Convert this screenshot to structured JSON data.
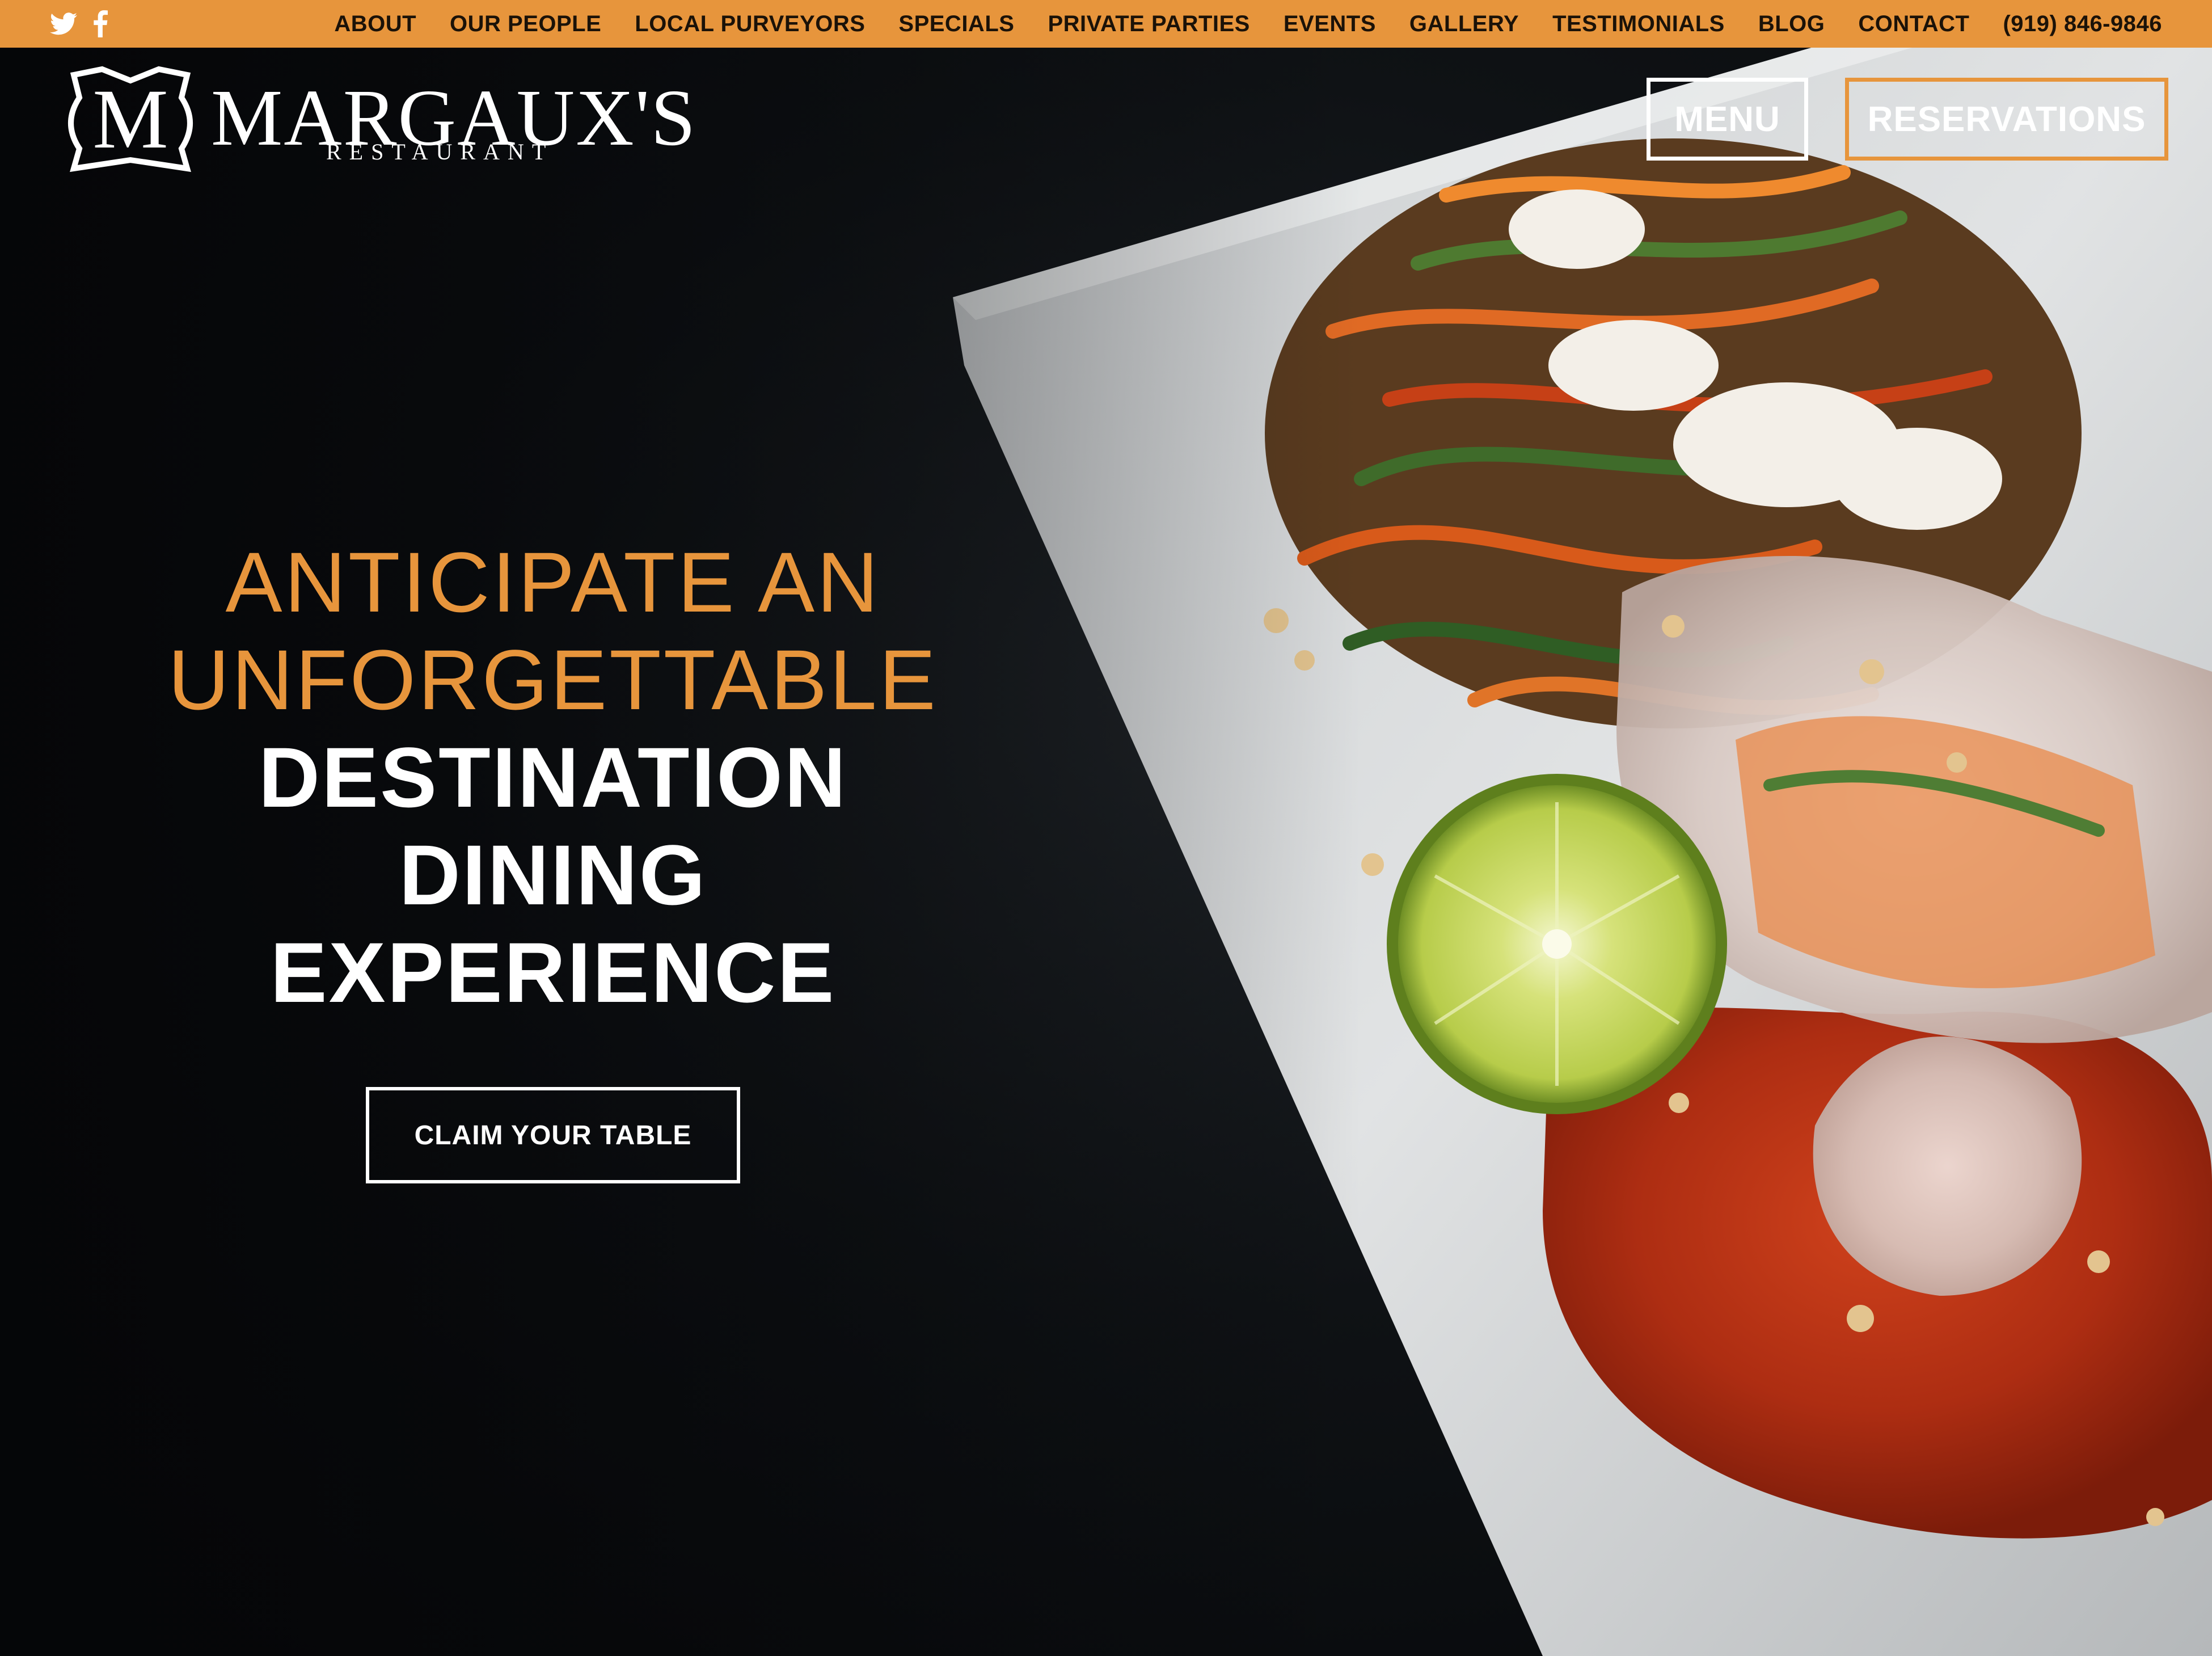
{
  "topbar": {
    "social": [
      {
        "icon": "twitter-icon"
      },
      {
        "icon": "facebook-icon"
      }
    ],
    "nav": [
      {
        "label": "ABOUT"
      },
      {
        "label": "OUR PEOPLE"
      },
      {
        "label": "LOCAL PURVEYORS"
      },
      {
        "label": "SPECIALS"
      },
      {
        "label": "PRIVATE PARTIES"
      },
      {
        "label": "EVENTS"
      },
      {
        "label": "GALLERY"
      },
      {
        "label": "TESTIMONIALS"
      },
      {
        "label": "BLOG"
      },
      {
        "label": "CONTACT"
      },
      {
        "label": "(919) 846-9846"
      }
    ]
  },
  "header": {
    "logo": {
      "monogram": "M",
      "name": "MARGAUX'S",
      "subtitle": "RESTAURANT"
    },
    "menu_button": "MENU",
    "reservations_button": "RESERVATIONS"
  },
  "hero": {
    "headline_light": [
      "ANTICIPATE AN",
      "UNFORGETTABLE"
    ],
    "headline_bold": [
      "DESTINATION",
      "DINING",
      "EXPERIENCE"
    ],
    "cta": "CLAIM YOUR TABLE"
  },
  "colors": {
    "accent": "#e7953c",
    "background": "#07090c",
    "text": "#ffffff"
  }
}
